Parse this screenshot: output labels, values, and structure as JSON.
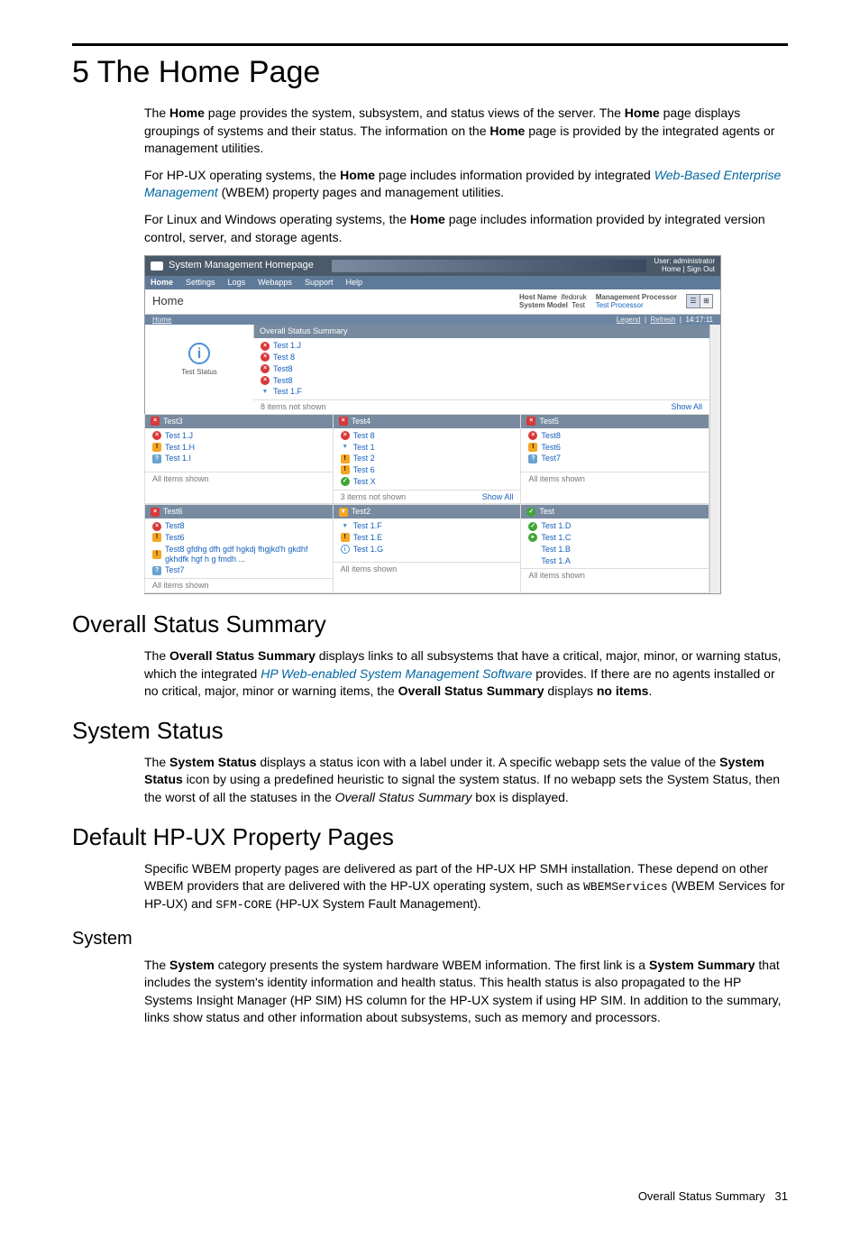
{
  "title": "5 The Home Page",
  "intro": [
    {
      "pre": "The ",
      "b1": "Home",
      "mid1": " page provides the system, subsystem, and status views of the server. The ",
      "b2": "Home",
      "mid2": " page displays groupings of systems and their status. The information on the ",
      "b3": "Home",
      "post": " page is provided by the integrated agents or management utilities."
    },
    {
      "text_pre": "For HP-UX operating systems, the ",
      "b": "Home",
      "text_mid": " page includes information provided by integrated ",
      "link": "Web-Based Enterprise Management",
      "text_post": " (WBEM) property pages and management utilities."
    },
    {
      "text_pre": "For Linux and Windows operating systems, the ",
      "b": "Home",
      "text_post": " page includes information provided by integrated version control, server, and storage agents."
    }
  ],
  "shot": {
    "app_title": "System Management Homepage",
    "user_label": "User: administrator",
    "links": "Home | Sign Out",
    "tabs": [
      "Home",
      "Settings",
      "Logs",
      "Webapps",
      "Support",
      "Help"
    ],
    "page_label": "Home",
    "sysinfo": {
      "host_label": "Host Name",
      "host_val": "ifedoruk",
      "model_label": "System Model",
      "model_val": "Test",
      "mp_label": "Management Processor",
      "mp_val": "Test Processor"
    },
    "crumb_left": "Home",
    "crumb_legend": "Legend",
    "crumb_refresh": "Refresh",
    "crumb_time": "14:17:11",
    "test_status": "Test Status",
    "oss_title": "Overall Status Summary",
    "oss_items": [
      {
        "icon": "crit",
        "label": "Test 1.J"
      },
      {
        "icon": "crit",
        "label": "Test 8"
      },
      {
        "icon": "crit",
        "label": "Test8"
      },
      {
        "icon": "crit",
        "label": "Test8"
      },
      {
        "icon": "warn-b",
        "label": "Test 1.F"
      }
    ],
    "oss_foot_left": "8 items not shown",
    "show_all": "Show All",
    "cards_row1": [
      {
        "head_icon": "maj",
        "title": "Test3",
        "items": [
          {
            "icon": "crit",
            "label": "Test 1.J"
          },
          {
            "icon": "min-i",
            "label": "Test 1.H"
          },
          {
            "icon": "unk",
            "label": "Test 1.I"
          }
        ],
        "foot_left": "All items shown",
        "foot_right": ""
      },
      {
        "head_icon": "maj",
        "title": "Test4",
        "items": [
          {
            "icon": "crit",
            "label": "Test 8"
          },
          {
            "icon": "warn-b",
            "label": "Test 1"
          },
          {
            "icon": "min-i",
            "label": "Test 2"
          },
          {
            "icon": "min-i",
            "label": "Test 6"
          },
          {
            "icon": "ok",
            "label": "Test X"
          }
        ],
        "foot_left": "3 items not shown",
        "foot_right": "Show All"
      },
      {
        "head_icon": "maj",
        "title": "Test5",
        "items": [
          {
            "icon": "crit",
            "label": "Test8"
          },
          {
            "icon": "min-i",
            "label": "Test6"
          },
          {
            "icon": "unk",
            "label": "Test7"
          }
        ],
        "foot_left": "All items shown",
        "foot_right": ""
      }
    ],
    "cards_row2": [
      {
        "head_icon": "maj",
        "title": "Test6",
        "items": [
          {
            "icon": "crit",
            "label": "Test8"
          },
          {
            "icon": "min-i",
            "label": "Test6"
          },
          {
            "icon": "min-i",
            "label": "Test8 gfdhg dfh gdf hgkdj fhgjkd'h gkdhf gkhdfk hgf h g fmdh ..."
          },
          {
            "icon": "unk",
            "label": "Test7"
          }
        ],
        "foot_left": "All items shown",
        "foot_right": ""
      },
      {
        "head_icon": "warn",
        "title": "Test2",
        "items": [
          {
            "icon": "warn-b",
            "label": "Test 1.F"
          },
          {
            "icon": "min-i",
            "label": "Test 1.E"
          },
          {
            "icon": "info-i",
            "label": "Test 1.G"
          }
        ],
        "foot_left": "All items shown",
        "foot_right": ""
      },
      {
        "head_icon": "ok",
        "title": "Test",
        "items": [
          {
            "icon": "ok",
            "label": "Test 1.D"
          },
          {
            "icon": "okp",
            "label": "Test 1.C"
          },
          {
            "icon": "blnk",
            "label": "Test 1.B"
          },
          {
            "icon": "blnk",
            "label": "Test 1.A"
          }
        ],
        "foot_left": "All items shown",
        "foot_right": ""
      }
    ]
  },
  "sections": {
    "oss": {
      "title": "Overall Status Summary",
      "p_pre": "The ",
      "p_b1": "Overall Status Summary",
      "p_mid1": " displays links to all subsystems that have a critical, major, minor, or warning status, which the integrated ",
      "p_link": "HP Web-enabled System Management Software",
      "p_mid2": " provides. If there are no agents installed or no critical, major, minor or warning items, the ",
      "p_b2": "Overall Status Summary",
      "p_mid3": " displays ",
      "p_b3": "no items",
      "p_post": "."
    },
    "sys_status": {
      "title": "System Status",
      "p_pre": "The ",
      "p_b1": "System Status",
      "p_mid1": " displays a status icon with a label under it. A specific webapp sets the value of the ",
      "p_b2": "System Status",
      "p_mid2": " icon by using a predefined heuristic to signal the system status. If no webapp sets the System Status, then the worst of all the statuses in the ",
      "p_i": "Overall Status Summary",
      "p_post": " box is displayed."
    },
    "hpux": {
      "title": "Default HP-UX Property Pages",
      "p_pre": "Specific WBEM property pages are delivered as part of the HP-UX HP SMH installation. These depend on other WBEM providers that are delivered with the HP-UX operating system, such as ",
      "p_m1": "WBEMServices",
      "p_mid": " (WBEM Services for HP-UX) and ",
      "p_m2": "SFM-CORE",
      "p_post": " (HP-UX System Fault Management)."
    },
    "system": {
      "title": "System",
      "p_pre": "The ",
      "p_b1": "System",
      "p_mid1": " category presents the system hardware WBEM information. The first link is a ",
      "p_b2": "System Summary",
      "p_post": " that includes the system's identity information and health status. This health status is also propagated to the HP Systems Insight Manager (HP SIM) HS column for the HP-UX system if using HP SIM. In addition to the summary, links show status and other information about subsystems, such as memory and processors."
    }
  },
  "footer": {
    "text": "Overall Status Summary",
    "page": "31"
  }
}
